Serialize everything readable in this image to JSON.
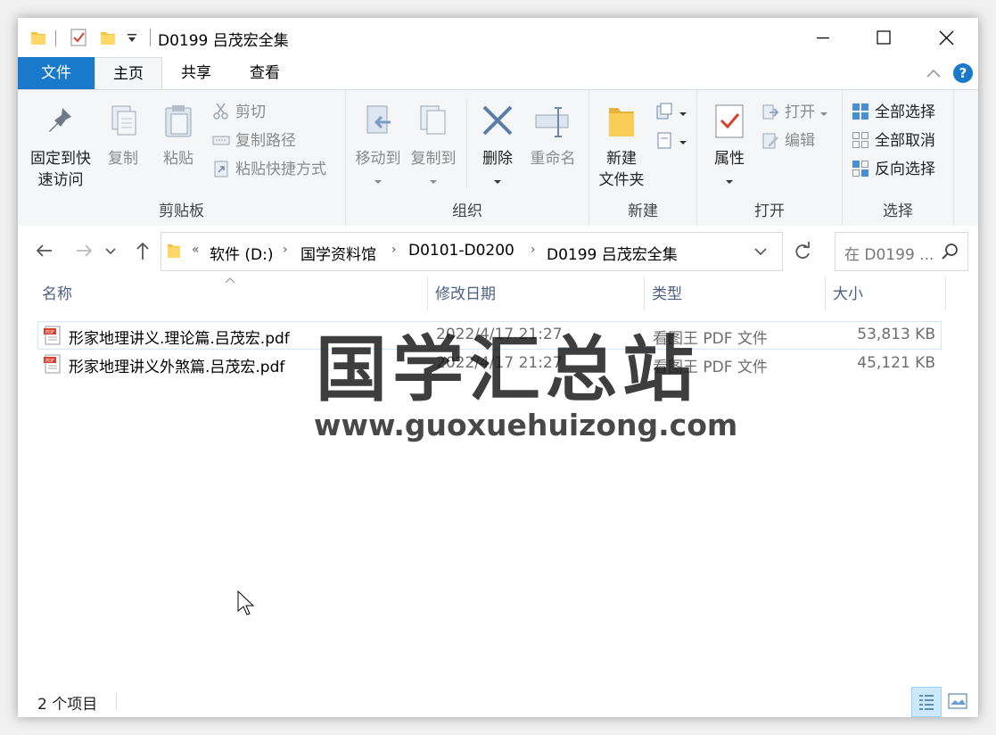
{
  "window": {
    "title": "D0199 吕茂宏全集"
  },
  "ribbon_tabs": [
    {
      "label": "文件"
    },
    {
      "label": "主页"
    },
    {
      "label": "共享"
    },
    {
      "label": "查看"
    }
  ],
  "ribbon": {
    "clipboard": {
      "label": "剪贴板",
      "pin": "固定到快\n速访问",
      "pin_line1": "固定到快",
      "pin_line2": "速访问",
      "copy": "复制",
      "paste": "粘贴",
      "cut": "剪切",
      "copy_path": "复制路径",
      "paste_shortcut": "粘贴快捷方式"
    },
    "organize": {
      "label": "组织",
      "move_to": "移动到",
      "copy_to": "复制到",
      "delete": "删除",
      "rename": "重命名"
    },
    "new": {
      "label": "新建",
      "new_folder_line1": "新建",
      "new_folder_line2": "文件夹"
    },
    "open": {
      "label": "打开",
      "properties": "属性",
      "open": "打开",
      "edit": "编辑"
    },
    "select": {
      "label": "选择",
      "select_all": "全部选择",
      "select_none": "全部取消",
      "invert": "反向选择"
    }
  },
  "breadcrumb": [
    "软件 (D:)",
    "国学资料馆",
    "D0101-D0200",
    "D0199 吕茂宏全集"
  ],
  "search": {
    "placeholder": "在 D0199 ..."
  },
  "columns": {
    "name": "名称",
    "modified": "修改日期",
    "type": "类型",
    "size": "大小"
  },
  "files": [
    {
      "name": "形家地理讲义.理论篇.吕茂宏.pdf",
      "modified": "2022/4/17 21:27",
      "type": "看图王 PDF 文件",
      "size": "53,813 KB"
    },
    {
      "name": "形家地理讲义外煞篇.吕茂宏.pdf",
      "modified": "2022/4/17 21:27",
      "type": "看图王 PDF 文件",
      "size": "45,121 KB"
    }
  ],
  "status": {
    "item_count": "2 个项目"
  },
  "watermark": {
    "title": "国学汇总站",
    "url": "www.guoxuehuizong.com"
  },
  "colors": {
    "accent": "#1979ca",
    "folder": "#f5c242",
    "header_text": "#4d6082"
  }
}
